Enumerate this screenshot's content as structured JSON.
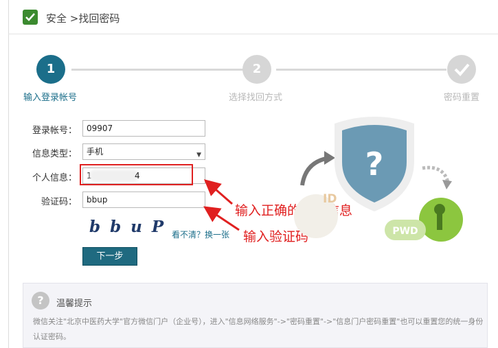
{
  "header": {
    "title": "安全 >找回密码",
    "logo_icon": "check-shield-icon"
  },
  "steps": [
    {
      "number": "1",
      "label": "输入登录帐号",
      "state": "active"
    },
    {
      "number": "2",
      "label": "选择找回方式",
      "state": "todo"
    },
    {
      "number": "",
      "label": "密码重置",
      "state": "todo",
      "icon": "check-icon"
    }
  ],
  "form": {
    "account_label": "登录帐号：",
    "account_value": "09907",
    "type_label": "信息类型：",
    "type_value": "手机",
    "info_label": "个人信息：",
    "info_value_start": "1",
    "info_value_end": "4",
    "code_label": "验证码：",
    "code_value": "bbup",
    "captcha_text": "bbuP",
    "refresh_link": "看不清？换一张",
    "next_button": "下一步"
  },
  "annotations": {
    "info_hint": "输入正确的相关信息",
    "code_hint": "输入验证码"
  },
  "illustration": {
    "id_text": "ID",
    "pwd_text": "PWD",
    "shield_symbol": "?"
  },
  "tips": {
    "title": "温馨提示",
    "body": "微信关注\"北京中医药大学\"官方微信门户（企业号），进入\"信息网络服务\"->\"密码重置\"->\"信息门户密码重置\"也可以重置您的统一身份认证密码。"
  },
  "colors": {
    "accent": "#1b6e8a",
    "annotation": "#e02020",
    "pwd_green": "#8cc63f"
  }
}
